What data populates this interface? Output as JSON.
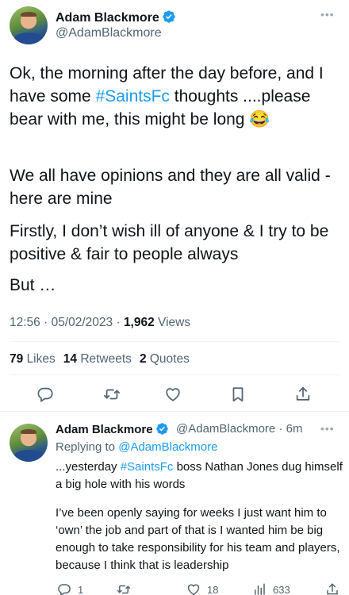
{
  "tweet": {
    "author_name": "Adam Blackmore",
    "author_handle": "@AdamBlackmore",
    "paragraphs": [
      {
        "before": "Ok, the morning after the day before, and I have some ",
        "hashtag": "#SaintsFc",
        "after": " thoughts ....please bear with me, this might be long 😂"
      },
      {
        "text": "We all have opinions and they are all valid - here are mine"
      },
      {
        "text": "Firstly, I don’t wish ill of anyone &  I try to be positive & fair to people always"
      },
      {
        "text": "But …"
      }
    ],
    "time": "12:56",
    "date": "05/02/2023",
    "views_count": "1,962",
    "views_label": "Views",
    "likes_count": "79",
    "likes_label": "Likes",
    "retweets_count": "14",
    "retweets_label": "Retweets",
    "quotes_count": "2",
    "quotes_label": "Quotes"
  },
  "reply": {
    "author_name": "Adam Blackmore",
    "author_handle": "@AdamBlackmore",
    "age": "6m",
    "replying_prefix": "Replying to ",
    "replying_to": "@AdamBlackmore",
    "para1_before": "...yesterday ",
    "para1_hashtag": "#SaintsFc",
    "para1_after": " boss Nathan Jones dug himself a big hole with his words",
    "para2": "I’ve been openly saying for weeks I just want him to ‘own’ the job and part of that is I wanted him be big enough to take responsibility for his team and players, because I think that is leadership",
    "reply_count": "1",
    "like_count": "18",
    "views_count": "633"
  },
  "icons": {
    "verified": "verified-badge-icon",
    "more": "more-options-icon",
    "reply": "reply-icon",
    "retweet": "retweet-icon",
    "like": "heart-icon",
    "bookmark": "bookmark-icon",
    "share": "share-icon",
    "views": "analytics-icon"
  },
  "colors": {
    "accent": "#1d9bf0",
    "secondary_text": "#536471",
    "primary_text": "#0f1419"
  }
}
